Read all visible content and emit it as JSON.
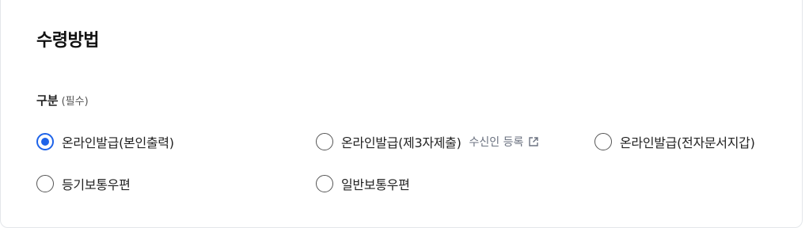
{
  "section": {
    "title": "수령방법"
  },
  "field": {
    "label": "구분",
    "required": "(필수)"
  },
  "options": [
    {
      "label": "온라인발급(본인출력)",
      "checked": true
    },
    {
      "label": "온라인발급(제3자제출)",
      "checked": false,
      "extra_link": "수신인 등록",
      "extra_icon": "external-link-icon"
    },
    {
      "label": "온라인발급(전자문서지갑)",
      "checked": false
    },
    {
      "label": "등기보통우편",
      "checked": false
    },
    {
      "label": "일반보통우편",
      "checked": false
    }
  ],
  "colors": {
    "accent": "#1e63e9",
    "border": "#e3e6ea",
    "muted_text": "#6b7280"
  }
}
